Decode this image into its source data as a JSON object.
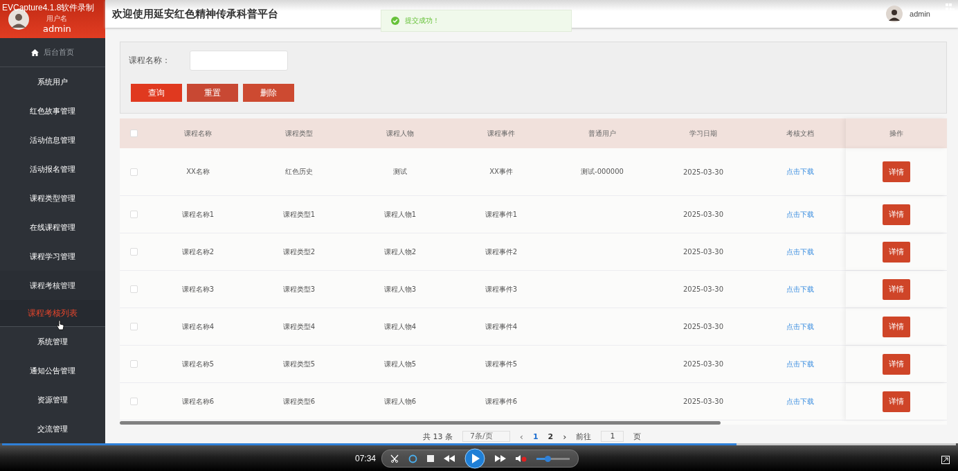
{
  "recorder": {
    "title": "EVCapture4.1.8软件录制",
    "time": "07:34",
    "progress": {
      "level": 0.77
    },
    "volume": {
      "level": 0.35
    }
  },
  "sidebar": {
    "user": {
      "label": "用户名",
      "name": "admin"
    },
    "home": "后台首页",
    "items": [
      {
        "label": "系统用户",
        "expanded": false
      },
      {
        "label": "红色故事管理",
        "expanded": false
      },
      {
        "label": "活动信息管理",
        "expanded": false
      },
      {
        "label": "活动报名管理",
        "expanded": false
      },
      {
        "label": "课程类型管理",
        "expanded": false
      },
      {
        "label": "在线课程管理",
        "expanded": false
      },
      {
        "label": "课程学习管理",
        "expanded": false
      },
      {
        "label": "课程考核管理",
        "expanded": true,
        "children": [
          {
            "label": "课程考核列表",
            "selected": true
          }
        ]
      },
      {
        "label": "系统管理",
        "expanded": false
      },
      {
        "label": "通知公告管理",
        "expanded": false
      },
      {
        "label": "资源管理",
        "expanded": false
      },
      {
        "label": "交流管理",
        "expanded": false
      }
    ]
  },
  "header": {
    "title": "欢迎使用延安红色精神传承科普平台",
    "user": "admin"
  },
  "toast": {
    "kind": "success",
    "text": "提交成功！"
  },
  "search": {
    "label": "课程名称：",
    "buttons": [
      {
        "label": "查询",
        "kind": "primary"
      },
      {
        "label": "重置",
        "kind": "reset"
      },
      {
        "label": "删除",
        "kind": "danger"
      }
    ]
  },
  "table": {
    "select_all": {
      "checked": false
    },
    "columns": [
      "课程名称",
      "课程类型",
      "课程人物",
      "课程事件",
      "普通用户",
      "学习日期",
      "考核文档",
      "操作"
    ],
    "rows": [
      {
        "checked": false,
        "cells": [
          "XX名称",
          "红色历史",
          "测试",
          "XX事件",
          "测试-000000",
          "2025-03-30"
        ],
        "link": "点击下载",
        "action": "详情"
      },
      {
        "checked": false,
        "cells": [
          "课程名称1",
          "课程类型1",
          "课程人物1",
          "课程事件1",
          "",
          "2025-03-30"
        ],
        "link": "点击下载",
        "action": "详情"
      },
      {
        "checked": false,
        "cells": [
          "课程名称2",
          "课程类型2",
          "课程人物2",
          "课程事件2",
          "",
          "2025-03-30"
        ],
        "link": "点击下载",
        "action": "详情"
      },
      {
        "checked": false,
        "cells": [
          "课程名称3",
          "课程类型3",
          "课程人物3",
          "课程事件3",
          "",
          "2025-03-30"
        ],
        "link": "点击下载",
        "action": "详情"
      },
      {
        "checked": false,
        "cells": [
          "课程名称4",
          "课程类型4",
          "课程人物4",
          "课程事件4",
          "",
          "2025-03-30"
        ],
        "link": "点击下载",
        "action": "详情"
      },
      {
        "checked": false,
        "cells": [
          "课程名称5",
          "课程类型5",
          "课程人物5",
          "课程事件5",
          "",
          "2025-03-30"
        ],
        "link": "点击下载",
        "action": "详情"
      },
      {
        "checked": false,
        "cells": [
          "课程名称6",
          "课程类型6",
          "课程人物6",
          "课程事件6",
          "",
          "2025-03-30"
        ],
        "link": "点击下载",
        "action": "详情"
      }
    ]
  },
  "pagination": {
    "total": "共 13 条",
    "page_size": "7条/页",
    "prev": "‹",
    "next": "›",
    "pages": [
      {
        "label": "1",
        "selected": true
      },
      {
        "label": "2",
        "selected": false
      }
    ],
    "goto_label": "前往",
    "goto_value": "1",
    "goto_suffix": "页"
  }
}
